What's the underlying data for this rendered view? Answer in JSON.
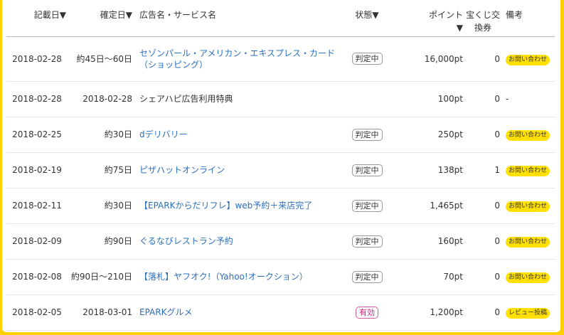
{
  "header": {
    "recorded": "記載日▼",
    "confirmed": "確定日▼",
    "name": "広告名・サービス名",
    "status": "状態▼",
    "points_label": "ポイント",
    "points_sort": "▼",
    "ticket": "宝くじ交換券",
    "note": "備考"
  },
  "rows": [
    {
      "recorded": "2018-02-28",
      "confirmed": "約45日〜60日",
      "name": "セゾンパール・アメリカン・エキスプレス・カード（ショッピング）",
      "status": "判定中",
      "points": "16,000pt",
      "tickets": "0",
      "note": "お問い合わせ"
    },
    {
      "recorded": "2018-02-28",
      "confirmed": "2018-02-28",
      "name": "シェアハピ広告利用特典",
      "status": "",
      "points": "100pt",
      "tickets": "0",
      "note": "-"
    },
    {
      "recorded": "2018-02-25",
      "confirmed": "約30日",
      "name": "dデリバリー",
      "status": "判定中",
      "points": "250pt",
      "tickets": "0",
      "note": "お問い合わせ"
    },
    {
      "recorded": "2018-02-19",
      "confirmed": "約75日",
      "name": "ピザハットオンライン",
      "status": "判定中",
      "points": "138pt",
      "tickets": "1",
      "note": "お問い合わせ"
    },
    {
      "recorded": "2018-02-11",
      "confirmed": "約30日",
      "name": "【EPARKからだリフレ】web予約＋来店完了",
      "status": "判定中",
      "points": "1,465pt",
      "tickets": "0",
      "note": "お問い合わせ"
    },
    {
      "recorded": "2018-02-09",
      "confirmed": "約90日",
      "name": "ぐるなびレストラン予約",
      "status": "判定中",
      "points": "160pt",
      "tickets": "0",
      "note": "お問い合わせ"
    },
    {
      "recorded": "2018-02-08",
      "confirmed": "約90日〜210日",
      "name": "【落札】ヤフオク!（Yahoo!オークション）",
      "status": "判定中",
      "points": "70pt",
      "tickets": "0",
      "note": "お問い合わせ"
    },
    {
      "recorded": "2018-02-05",
      "confirmed": "2018-03-01",
      "name": "EPARKグルメ",
      "status": "有効",
      "points": "1,200pt",
      "tickets": "0",
      "note": "レビュー投稿"
    }
  ],
  "colors": {
    "frame": "#ffd100",
    "link": "#2a6fbd",
    "pill": "#ffe000",
    "valid": "#d01f83"
  }
}
